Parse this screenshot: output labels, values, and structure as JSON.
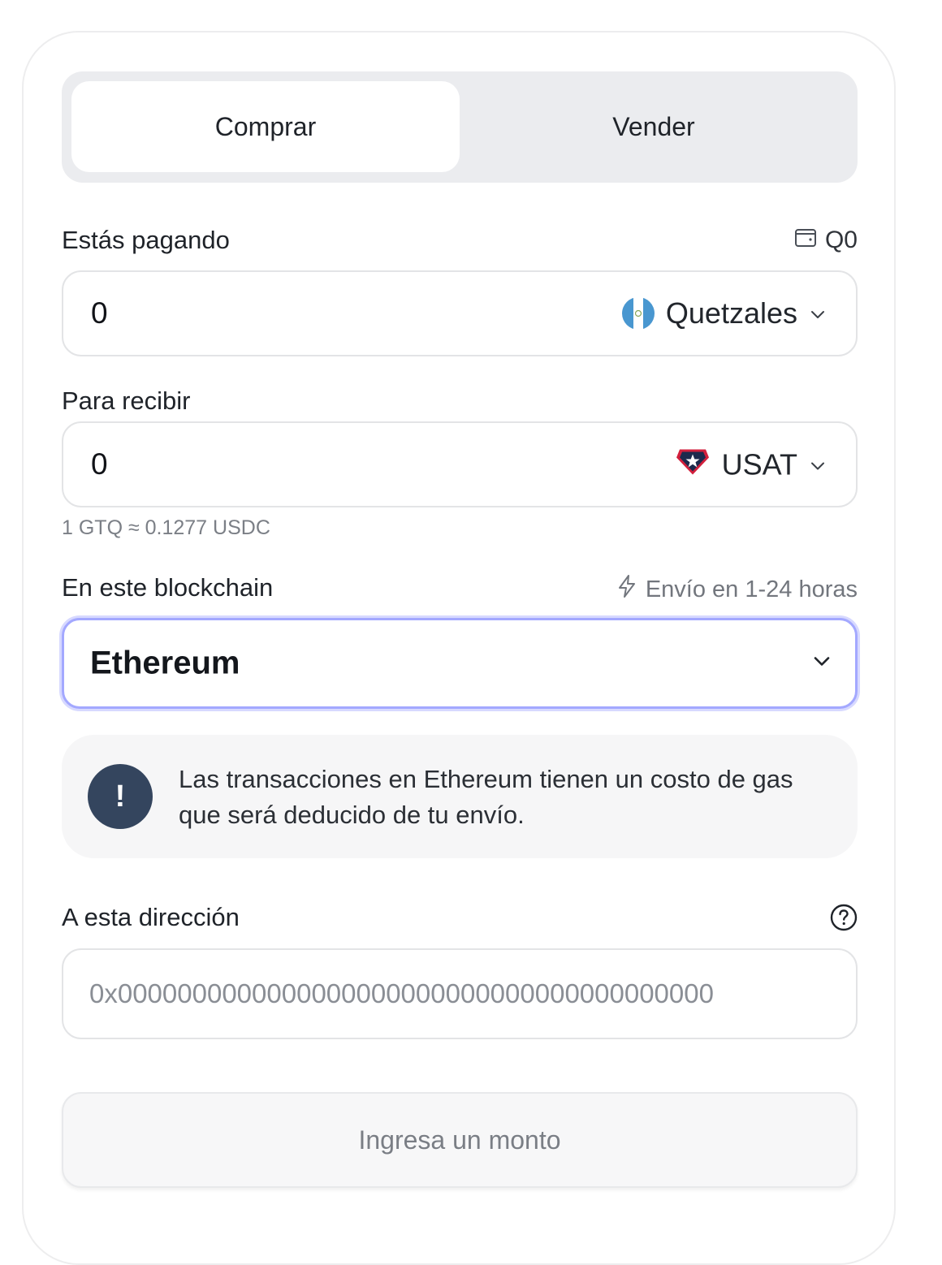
{
  "tabs": {
    "buy": "Comprar",
    "sell": "Vender"
  },
  "pay": {
    "label": "Estás pagando",
    "balance": "Q0",
    "amount": "0",
    "currency": "Quetzales",
    "currency_icon": "guatemala-flag-icon"
  },
  "receive": {
    "label": "Para recibir",
    "amount": "0",
    "currency": "USAT",
    "currency_icon": "usat-token-icon"
  },
  "rate": "1 GTQ ≈ 0.1277 USDC",
  "blockchain": {
    "label": "En este blockchain",
    "speed": "Envío en 1-24 horas",
    "selected": "Ethereum"
  },
  "notice": {
    "icon": "!",
    "text": "Las transacciones en Ethereum tienen un costo de gas que será deducido de tu envío."
  },
  "address": {
    "label": "A esta dirección",
    "value": "",
    "placeholder": "0x0000000000000000000000000000000000000000"
  },
  "submit_label": "Ingresa un monto",
  "colors": {
    "tabs_bg": "#ebecef",
    "focus_ring": "#a3a8ff",
    "notice_icon_bg": "#34455e",
    "flag_blue": "#4997d0",
    "usat_red": "#d21f3c",
    "usat_navy": "#1c2a4d"
  }
}
